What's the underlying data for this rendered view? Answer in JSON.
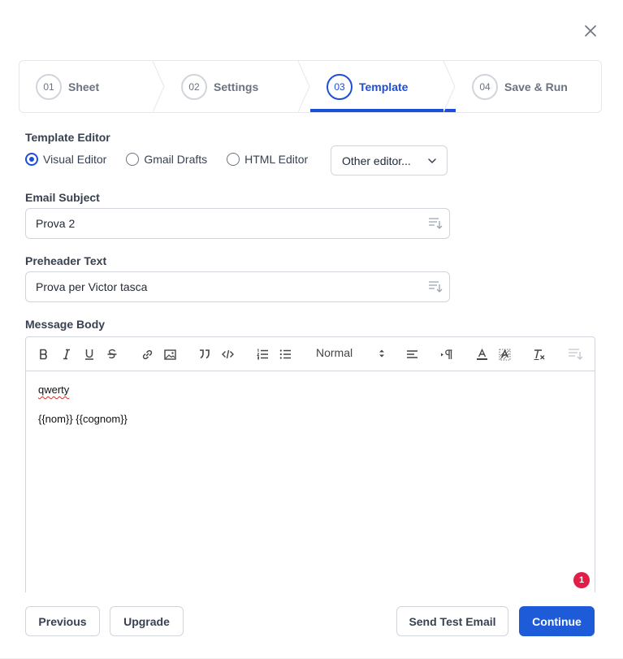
{
  "steps": [
    {
      "num": "01",
      "label": "Sheet"
    },
    {
      "num": "02",
      "label": "Settings"
    },
    {
      "num": "03",
      "label": "Template"
    },
    {
      "num": "04",
      "label": "Save & Run"
    }
  ],
  "active_step": "03",
  "template_editor": {
    "label": "Template Editor",
    "options": [
      "Visual Editor",
      "Gmail Drafts",
      "HTML Editor"
    ],
    "selected": "Visual Editor",
    "other_editor_label": "Other editor..."
  },
  "email_subject": {
    "label": "Email Subject",
    "value": "Prova 2"
  },
  "preheader": {
    "label": "Preheader Text",
    "value": "Prova per Victor tasca"
  },
  "message_body": {
    "label": "Message Body",
    "format": "Normal",
    "lines": [
      "qwerty",
      "{{nom}} {{cognom}}"
    ]
  },
  "notification_count": "1",
  "footer": {
    "previous": "Previous",
    "upgrade": "Upgrade",
    "send_test": "Send Test Email",
    "continue": "Continue"
  },
  "colors": {
    "accent": "#1d4ed8",
    "badge": "#e11d48"
  }
}
